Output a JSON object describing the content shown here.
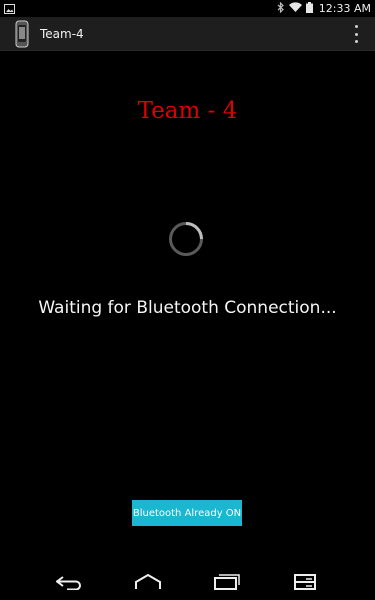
{
  "status_bar": {
    "time": "12:33 AM",
    "icons": [
      "image-notification-icon",
      "bluetooth-icon",
      "wifi-icon",
      "battery-icon"
    ]
  },
  "action_bar": {
    "app_title": "Team-4",
    "icons": [
      "app-icon",
      "overflow-menu-icon"
    ]
  },
  "main": {
    "title": "Team - 4",
    "title_color": "#e00000",
    "status_text": "Waiting for Bluetooth Connection...",
    "spinner": "loading-spinner-icon",
    "button_label": "Bluetooth Already ON",
    "button_color": "#1bb6cf"
  },
  "nav_bar": {
    "icons": [
      "back-icon",
      "home-icon",
      "recent-apps-icon",
      "menu-icon"
    ]
  }
}
